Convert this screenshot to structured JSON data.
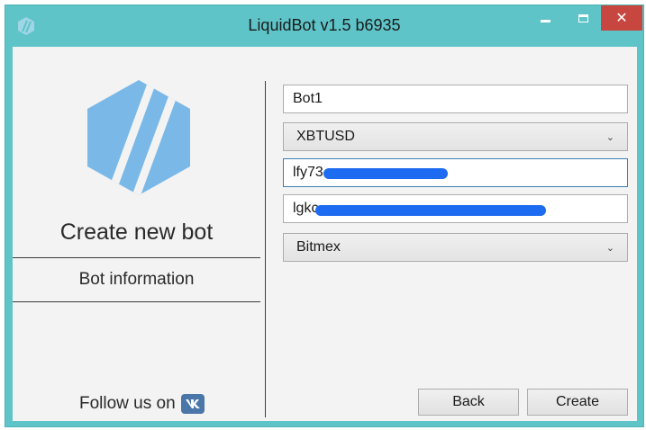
{
  "window": {
    "title": "LiquidBot v1.5 b6935",
    "close_glyph": "✕"
  },
  "sidebar": {
    "heading": "Create new bot",
    "active_step": "Bot information",
    "follow_text": "Follow us on",
    "vk_label": "vk"
  },
  "form": {
    "bot_name": "Bot1",
    "symbol": "XBTUSD",
    "api_key": "lfy73",
    "api_secret": "lgkc",
    "exchange": "Bitmex",
    "chevron": "⌄"
  },
  "buttons": {
    "back": "Back",
    "create": "Create"
  },
  "colors": {
    "titlebar": "#5ec4c8",
    "close": "#c7463f",
    "logo": "#7ab8e8",
    "redaction": "#1d6bf0",
    "vk": "#4a76a8"
  },
  "icons": {
    "app": "liquidbot-app-icon",
    "logo": "liquidbot-hexagon-logo",
    "vk": "vk-icon"
  }
}
